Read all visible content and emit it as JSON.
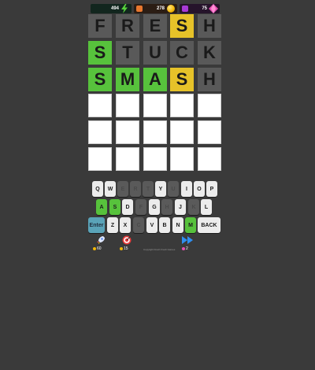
{
  "status": {
    "energy": "494",
    "coins": "278",
    "gems": "75"
  },
  "board": [
    [
      {
        "letter": "F",
        "state": "gray"
      },
      {
        "letter": "R",
        "state": "gray"
      },
      {
        "letter": "E",
        "state": "gray"
      },
      {
        "letter": "S",
        "state": "yellow"
      },
      {
        "letter": "H",
        "state": "gray"
      }
    ],
    [
      {
        "letter": "S",
        "state": "green"
      },
      {
        "letter": "T",
        "state": "gray"
      },
      {
        "letter": "U",
        "state": "gray"
      },
      {
        "letter": "C",
        "state": "gray"
      },
      {
        "letter": "K",
        "state": "gray"
      }
    ],
    [
      {
        "letter": "S",
        "state": "green"
      },
      {
        "letter": "M",
        "state": "green"
      },
      {
        "letter": "A",
        "state": "green"
      },
      {
        "letter": "S",
        "state": "yellow"
      },
      {
        "letter": "H",
        "state": "gray"
      }
    ],
    [
      {
        "letter": "",
        "state": "empty"
      },
      {
        "letter": "",
        "state": "empty"
      },
      {
        "letter": "",
        "state": "empty"
      },
      {
        "letter": "",
        "state": "empty"
      },
      {
        "letter": "",
        "state": "empty"
      }
    ],
    [
      {
        "letter": "",
        "state": "empty"
      },
      {
        "letter": "",
        "state": "empty"
      },
      {
        "letter": "",
        "state": "empty"
      },
      {
        "letter": "",
        "state": "empty"
      },
      {
        "letter": "",
        "state": "empty"
      }
    ],
    [
      {
        "letter": "",
        "state": "empty"
      },
      {
        "letter": "",
        "state": "empty"
      },
      {
        "letter": "",
        "state": "empty"
      },
      {
        "letter": "",
        "state": "empty"
      },
      {
        "letter": "",
        "state": "empty"
      }
    ]
  ],
  "keyboard": [
    [
      {
        "label": "Q",
        "state": "unused"
      },
      {
        "label": "W",
        "state": "unused"
      },
      {
        "label": "E",
        "state": "absent"
      },
      {
        "label": "R",
        "state": "absent"
      },
      {
        "label": "T",
        "state": "absent"
      },
      {
        "label": "Y",
        "state": "unused"
      },
      {
        "label": "U",
        "state": "absent"
      },
      {
        "label": "I",
        "state": "unused"
      },
      {
        "label": "O",
        "state": "unused"
      },
      {
        "label": "P",
        "state": "unused"
      }
    ],
    [
      {
        "label": "A",
        "state": "correct"
      },
      {
        "label": "S",
        "state": "correct"
      },
      {
        "label": "D",
        "state": "unused"
      },
      {
        "label": "F",
        "state": "absent"
      },
      {
        "label": "G",
        "state": "unused"
      },
      {
        "label": "H",
        "state": "absent"
      },
      {
        "label": "J",
        "state": "unused"
      },
      {
        "label": "K",
        "state": "absent"
      },
      {
        "label": "L",
        "state": "unused"
      }
    ],
    [
      {
        "label": "Enter",
        "state": "enter"
      },
      {
        "label": "Z",
        "state": "unused"
      },
      {
        "label": "X",
        "state": "unused"
      },
      {
        "label": "C",
        "state": "absent"
      },
      {
        "label": "V",
        "state": "unused"
      },
      {
        "label": "B",
        "state": "unused"
      },
      {
        "label": "N",
        "state": "unused"
      },
      {
        "label": "M",
        "state": "correct"
      },
      {
        "label": "BACK",
        "state": "unused"
      }
    ]
  ],
  "powerups": {
    "hint_rocket": {
      "icon": "rocket-icon",
      "count": "60"
    },
    "target": {
      "icon": "target-icon",
      "count": "15"
    },
    "skip": {
      "icon": "fast-forward-icon",
      "count": "2"
    }
  },
  "footer": {
    "copyright": "Copyright Fresh Fresh Games"
  },
  "colors": {
    "background": "#3a3a3a",
    "correct": "#57c23c",
    "present": "#e6c229",
    "absent": "#595959"
  }
}
